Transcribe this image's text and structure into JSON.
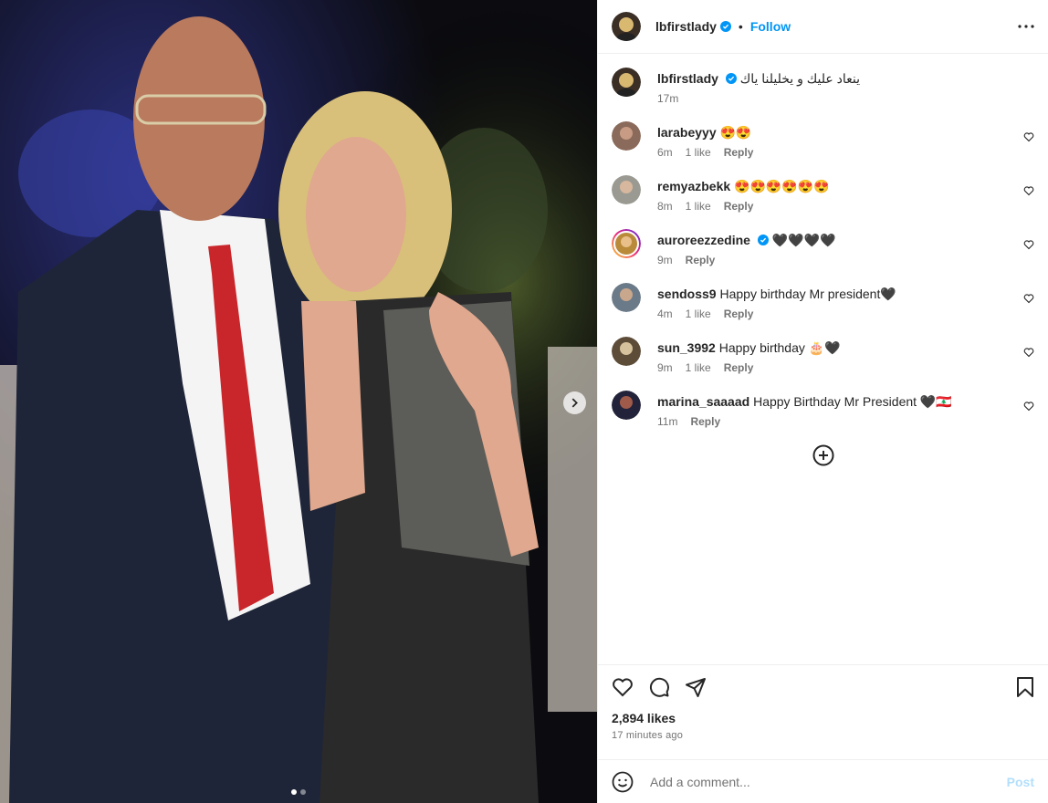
{
  "post": {
    "username": "lbfirstlady",
    "follow_label": "Follow",
    "separator": "•",
    "caption": "ينعاد عليك و يخليلنا ياك",
    "caption_time": "17m",
    "likes": "2,894 likes",
    "timestamp": "17 minutes ago",
    "carousel": {
      "slides": 2,
      "active": 0
    }
  },
  "comments": [
    {
      "user": "larabeyyy",
      "text": "😍😍",
      "time": "6m",
      "likes": "1 like",
      "reply": "Reply",
      "verified": false
    },
    {
      "user": "remyazbekk",
      "text": "😍😍😍😍😍😍",
      "time": "8m",
      "likes": "1 like",
      "reply": "Reply",
      "verified": false
    },
    {
      "user": "auroreezzedine",
      "text": "🖤🖤🖤🖤",
      "time": "9m",
      "likes": "",
      "reply": "Reply",
      "verified": true
    },
    {
      "user": "sendoss9",
      "text": "Happy birthday Mr president🖤",
      "time": "4m",
      "likes": "1 like",
      "reply": "Reply",
      "verified": false
    },
    {
      "user": "sun_3992",
      "text": "Happy birthday 🎂🖤",
      "time": "9m",
      "likes": "1 like",
      "reply": "Reply",
      "verified": false
    },
    {
      "user": "marina_saaaad",
      "text": "Happy Birthday Mr President 🖤🇱🇧",
      "time": "11m",
      "likes": "",
      "reply": "Reply",
      "verified": false
    }
  ],
  "add_comment": {
    "placeholder": "Add a comment...",
    "post_label": "Post"
  },
  "colors": {
    "accent": "#0095f6",
    "post_disabled": "#b2dffc"
  }
}
